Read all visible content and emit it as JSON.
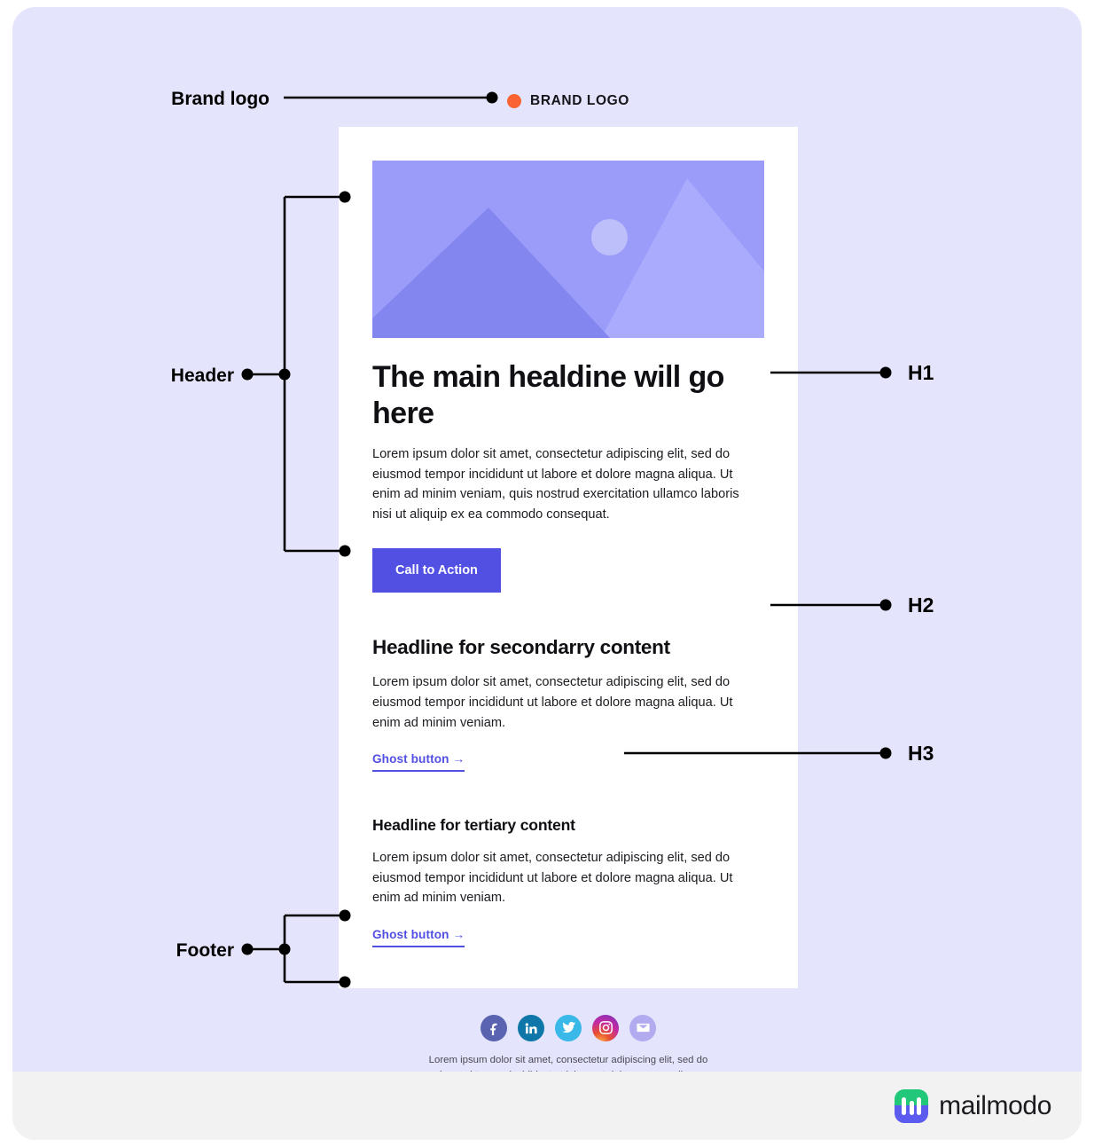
{
  "page": {
    "background_color": "#e4e4fc",
    "bottom_bar_color": "#f2f2f2"
  },
  "annotations": {
    "brand_logo": "Brand logo",
    "header": "Header",
    "footer": "Footer",
    "h1": "H1",
    "h2": "H2",
    "h3": "H3"
  },
  "email": {
    "brand_logo": {
      "text": "BRAND LOGO",
      "dot_color": "#fa6432"
    },
    "hero_image": {
      "sky_color": "#9b9cfa",
      "left_mountain_color": "#8286ee",
      "right_mountain_color": "#aaabfc",
      "sun_color": "#bdbffb"
    },
    "h1_title": "The main healdine will go here",
    "h1_body": "Lorem ipsum dolor sit amet, consectetur adipiscing elit, sed do eiusmod tempor incididunt ut labore et dolore magna aliqua. Ut enim ad minim veniam, quis nostrud exercitation ullamco laboris nisi ut aliquip ex ea commodo consequat.",
    "cta_label": "Call to Action",
    "cta_color": "#5150e2",
    "h2_title": "Headline for secondarry content",
    "h2_body": "Lorem ipsum dolor sit amet, consectetur adipiscing elit, sed do eiusmod tempor incididunt ut labore et dolore magna aliqua. Ut enim ad minim veniam.",
    "ghost_button_1": "Ghost button",
    "h3_title": "Headline for tertiary content",
    "h3_body": "Lorem ipsum dolor sit amet, consectetur adipiscing elit, sed do eiusmod tempor incididunt ut labore et dolore magna aliqua. Ut enim ad minim veniam.",
    "ghost_button_2": "Ghost button",
    "ghost_arrow": "→",
    "footer": {
      "social_icons": [
        {
          "name": "facebook-icon",
          "color": "#5a63b0"
        },
        {
          "name": "linkedin-icon",
          "color": "#0e76a8"
        },
        {
          "name": "twitter-icon",
          "color": "#3ab8e8"
        },
        {
          "name": "instagram-icon",
          "color": "#c32aa3"
        },
        {
          "name": "email-icon",
          "color": "#b2abf0"
        }
      ],
      "text": "Lorem ipsum dolor sit amet, consectetur adipiscing elit, sed do eiusmod tempor incididunt ut labore et dolore magna aliqua."
    }
  },
  "branding": {
    "product_name": "mailmodo",
    "logo_top_color": "#21c879",
    "logo_bottom_color": "#5b5bf0"
  }
}
